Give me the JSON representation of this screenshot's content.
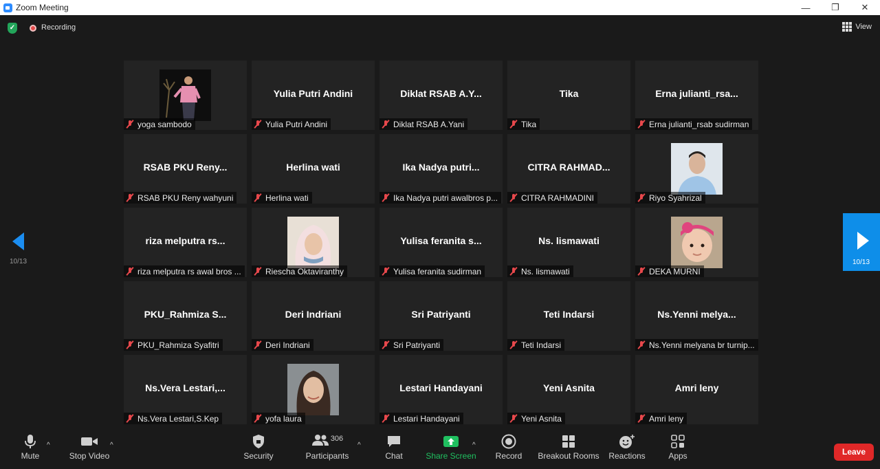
{
  "window": {
    "title": "Zoom Meeting",
    "controls": [
      "—",
      "❐",
      "✕"
    ]
  },
  "topbar": {
    "recording_label": "Recording",
    "view_label": "View"
  },
  "pagination": {
    "prev_page": "10/13",
    "next_page": "10/13"
  },
  "participants": [
    {
      "display": "",
      "tag": "yoga sambodo",
      "photo": "man-pink-shirt"
    },
    {
      "display": "Yulia Putri Andini",
      "tag": "Yulia Putri Andini"
    },
    {
      "display": "Diklat RSAB A.Y...",
      "tag": "Diklat RSAB A.Yani"
    },
    {
      "display": "Tika",
      "tag": "Tika"
    },
    {
      "display": "Erna  julianti_rsa...",
      "tag": "Erna julianti_rsab sudirman"
    },
    {
      "display": "RSAB PKU Reny...",
      "tag": "RSAB PKU Reny wahyuni"
    },
    {
      "display": "Herlina wati",
      "tag": "Herlina wati"
    },
    {
      "display": "Ika Nadya  putri...",
      "tag": "Ika Nadya putri awalbros p..."
    },
    {
      "display": "CITRA  RAHMAD...",
      "tag": "CITRA RAHMADINI"
    },
    {
      "display": "",
      "tag": "Riyo Syahrizal",
      "photo": "man-blue-shirt"
    },
    {
      "display": "riza melputra rs...",
      "tag": "riza melputra rs awal bros ..."
    },
    {
      "display": "",
      "tag": "Riescha Oktaviranthy",
      "photo": "woman-hijab"
    },
    {
      "display": "Yulisa feranita s...",
      "tag": "Yulisa feranita sudirman"
    },
    {
      "display": "Ns. lismawati",
      "tag": "Ns. lismawati"
    },
    {
      "display": "",
      "tag": "DEKA MURNI",
      "photo": "baby-pink-headband"
    },
    {
      "display": "PKU_Rahmiza  S...",
      "tag": "PKU_Rahmiza Syafitri"
    },
    {
      "display": "Deri Indriani",
      "tag": "Deri Indriani"
    },
    {
      "display": "Sri Patriyanti",
      "tag": "Sri Patriyanti"
    },
    {
      "display": "Teti Indarsi",
      "tag": "Teti Indarsi"
    },
    {
      "display": "Ns.Yenni  melya...",
      "tag": "Ns.Yenni melyana br turnip..."
    },
    {
      "display": "Ns.Vera  Lestari,...",
      "tag": "Ns.Vera Lestari,S.Kep"
    },
    {
      "display": "",
      "tag": "yofa laura",
      "photo": "woman-smiling"
    },
    {
      "display": "Lestari Handayani",
      "tag": "Lestari Handayani"
    },
    {
      "display": "Yeni Asnita",
      "tag": "Yeni Asnita"
    },
    {
      "display": "Amri leny",
      "tag": "Amri leny"
    }
  ],
  "toolbar": {
    "mute": "Mute",
    "stop_video": "Stop Video",
    "security": "Security",
    "participants": "Participants",
    "participants_count": "306",
    "chat": "Chat",
    "share_screen": "Share Screen",
    "record": "Record",
    "breakout_rooms": "Breakout Rooms",
    "reactions": "Reactions",
    "apps": "Apps",
    "leave": "Leave"
  },
  "colors": {
    "accent": "#0e8ee9",
    "share_green": "#20c060",
    "leave_red": "#e02828",
    "muted_red": "#e8484c"
  }
}
